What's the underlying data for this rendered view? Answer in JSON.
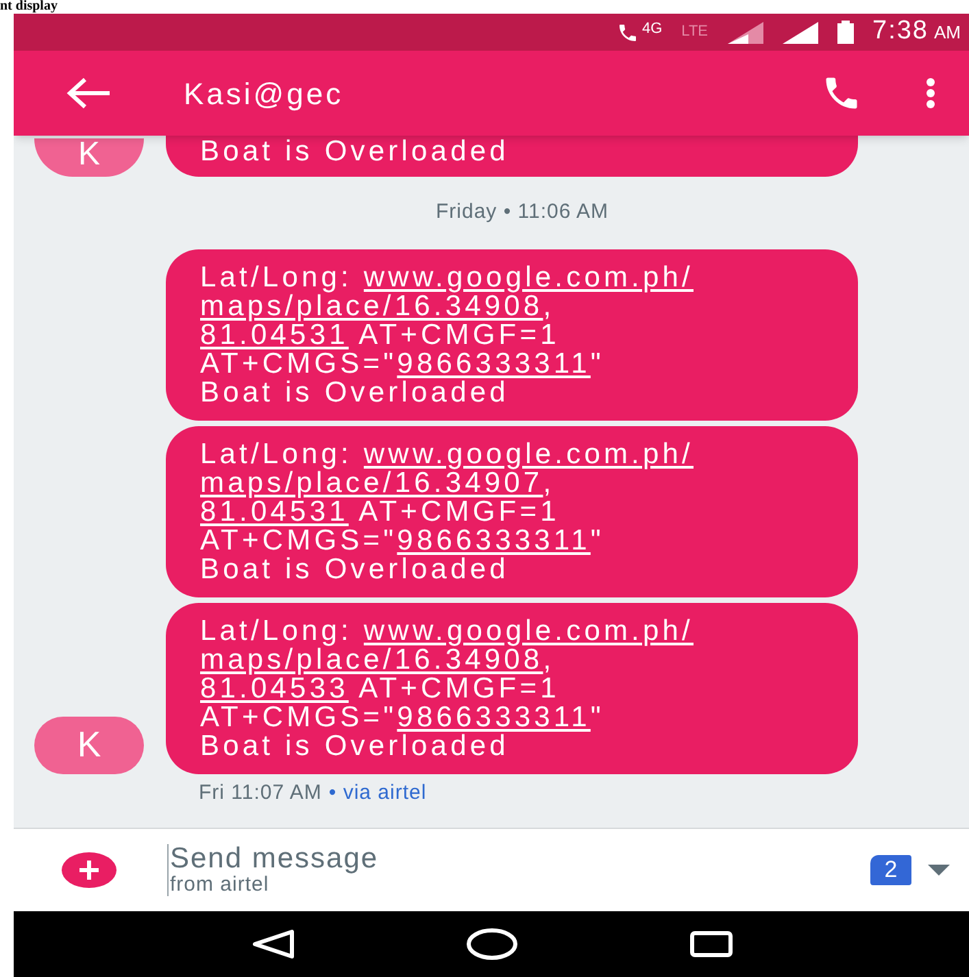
{
  "caption": "nt display",
  "status_bar": {
    "network": "4G",
    "lte": "LTE",
    "time": "7:38",
    "time_suffix": "AM"
  },
  "app_bar": {
    "title": "Kasi@gec"
  },
  "messages_before": [
    {
      "show_avatar": true,
      "avatar_letter": "K",
      "lines": [
        [
          {
            "text": "Boat is Overloaded"
          }
        ]
      ]
    }
  ],
  "date_divider": "Friday • 11:06 AM",
  "messages": [
    {
      "show_avatar": false,
      "lines": [
        [
          {
            "text": "Lat/Long: "
          },
          {
            "text": "www.google.com.ph/",
            "link": true
          }
        ],
        [
          {
            "text": "maps/place/16.34908",
            "link": true
          },
          {
            "text": ","
          }
        ],
        [
          {
            "text": "81.04531",
            "link": true
          },
          {
            "text": " AT+CMGF=1"
          }
        ],
        [
          {
            "text": "AT+CMGS=\""
          },
          {
            "text": "9866333311",
            "link": true
          },
          {
            "text": "\""
          }
        ],
        [
          {
            "text": "Boat is Overloaded"
          }
        ]
      ]
    },
    {
      "show_avatar": false,
      "lines": [
        [
          {
            "text": "Lat/Long: "
          },
          {
            "text": "www.google.com.ph/",
            "link": true
          }
        ],
        [
          {
            "text": "maps/place/16.34907",
            "link": true
          },
          {
            "text": ","
          }
        ],
        [
          {
            "text": "81.04531",
            "link": true
          },
          {
            "text": " AT+CMGF=1"
          }
        ],
        [
          {
            "text": "AT+CMGS=\""
          },
          {
            "text": "9866333311",
            "link": true
          },
          {
            "text": "\""
          }
        ],
        [
          {
            "text": "Boat is Overloaded"
          }
        ]
      ]
    },
    {
      "show_avatar": true,
      "avatar_letter": "K",
      "lines": [
        [
          {
            "text": "Lat/Long: "
          },
          {
            "text": "www.google.com.ph/",
            "link": true
          }
        ],
        [
          {
            "text": "maps/place/16.34908",
            "link": true
          },
          {
            "text": ","
          }
        ],
        [
          {
            "text": "81.04533",
            "link": true
          },
          {
            "text": " AT+CMGF=1"
          }
        ],
        [
          {
            "text": "AT+CMGS=\""
          },
          {
            "text": "9866333311",
            "link": true
          },
          {
            "text": "\""
          }
        ],
        [
          {
            "text": "Boat is Overloaded"
          }
        ]
      ]
    }
  ],
  "message_meta": {
    "time": "Fri 11:07 AM",
    "via": "• via airtel"
  },
  "composer": {
    "placeholder": "Send message",
    "sim_label": "from airtel",
    "sim_number": "2"
  }
}
